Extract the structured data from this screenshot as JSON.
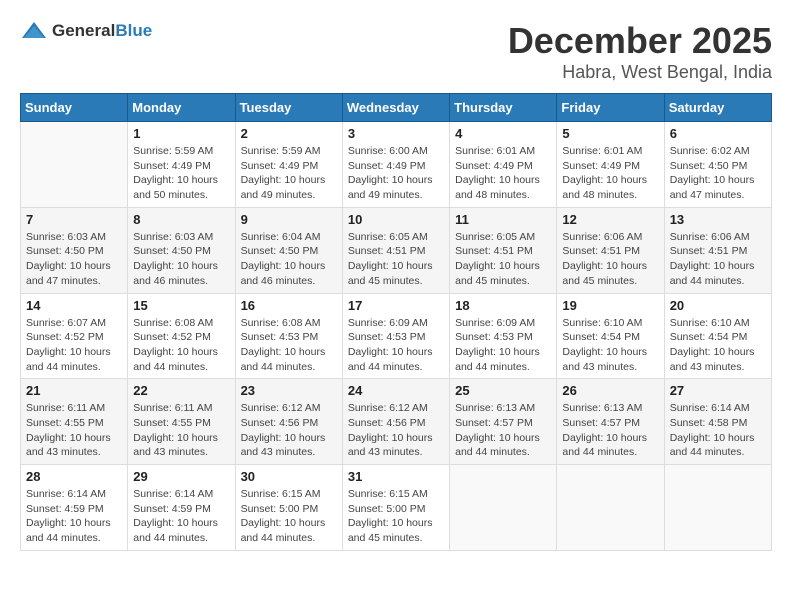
{
  "logo": {
    "general": "General",
    "blue": "Blue"
  },
  "title": {
    "month": "December 2025",
    "location": "Habra, West Bengal, India"
  },
  "weekdays": [
    "Sunday",
    "Monday",
    "Tuesday",
    "Wednesday",
    "Thursday",
    "Friday",
    "Saturday"
  ],
  "weeks": [
    [
      {
        "day": "",
        "sunrise": "",
        "sunset": "",
        "daylight": ""
      },
      {
        "day": "1",
        "sunrise": "Sunrise: 5:59 AM",
        "sunset": "Sunset: 4:49 PM",
        "daylight": "Daylight: 10 hours and 50 minutes."
      },
      {
        "day": "2",
        "sunrise": "Sunrise: 5:59 AM",
        "sunset": "Sunset: 4:49 PM",
        "daylight": "Daylight: 10 hours and 49 minutes."
      },
      {
        "day": "3",
        "sunrise": "Sunrise: 6:00 AM",
        "sunset": "Sunset: 4:49 PM",
        "daylight": "Daylight: 10 hours and 49 minutes."
      },
      {
        "day": "4",
        "sunrise": "Sunrise: 6:01 AM",
        "sunset": "Sunset: 4:49 PM",
        "daylight": "Daylight: 10 hours and 48 minutes."
      },
      {
        "day": "5",
        "sunrise": "Sunrise: 6:01 AM",
        "sunset": "Sunset: 4:49 PM",
        "daylight": "Daylight: 10 hours and 48 minutes."
      },
      {
        "day": "6",
        "sunrise": "Sunrise: 6:02 AM",
        "sunset": "Sunset: 4:50 PM",
        "daylight": "Daylight: 10 hours and 47 minutes."
      }
    ],
    [
      {
        "day": "7",
        "sunrise": "Sunrise: 6:03 AM",
        "sunset": "Sunset: 4:50 PM",
        "daylight": "Daylight: 10 hours and 47 minutes."
      },
      {
        "day": "8",
        "sunrise": "Sunrise: 6:03 AM",
        "sunset": "Sunset: 4:50 PM",
        "daylight": "Daylight: 10 hours and 46 minutes."
      },
      {
        "day": "9",
        "sunrise": "Sunrise: 6:04 AM",
        "sunset": "Sunset: 4:50 PM",
        "daylight": "Daylight: 10 hours and 46 minutes."
      },
      {
        "day": "10",
        "sunrise": "Sunrise: 6:05 AM",
        "sunset": "Sunset: 4:51 PM",
        "daylight": "Daylight: 10 hours and 45 minutes."
      },
      {
        "day": "11",
        "sunrise": "Sunrise: 6:05 AM",
        "sunset": "Sunset: 4:51 PM",
        "daylight": "Daylight: 10 hours and 45 minutes."
      },
      {
        "day": "12",
        "sunrise": "Sunrise: 6:06 AM",
        "sunset": "Sunset: 4:51 PM",
        "daylight": "Daylight: 10 hours and 45 minutes."
      },
      {
        "day": "13",
        "sunrise": "Sunrise: 6:06 AM",
        "sunset": "Sunset: 4:51 PM",
        "daylight": "Daylight: 10 hours and 44 minutes."
      }
    ],
    [
      {
        "day": "14",
        "sunrise": "Sunrise: 6:07 AM",
        "sunset": "Sunset: 4:52 PM",
        "daylight": "Daylight: 10 hours and 44 minutes."
      },
      {
        "day": "15",
        "sunrise": "Sunrise: 6:08 AM",
        "sunset": "Sunset: 4:52 PM",
        "daylight": "Daylight: 10 hours and 44 minutes."
      },
      {
        "day": "16",
        "sunrise": "Sunrise: 6:08 AM",
        "sunset": "Sunset: 4:53 PM",
        "daylight": "Daylight: 10 hours and 44 minutes."
      },
      {
        "day": "17",
        "sunrise": "Sunrise: 6:09 AM",
        "sunset": "Sunset: 4:53 PM",
        "daylight": "Daylight: 10 hours and 44 minutes."
      },
      {
        "day": "18",
        "sunrise": "Sunrise: 6:09 AM",
        "sunset": "Sunset: 4:53 PM",
        "daylight": "Daylight: 10 hours and 44 minutes."
      },
      {
        "day": "19",
        "sunrise": "Sunrise: 6:10 AM",
        "sunset": "Sunset: 4:54 PM",
        "daylight": "Daylight: 10 hours and 43 minutes."
      },
      {
        "day": "20",
        "sunrise": "Sunrise: 6:10 AM",
        "sunset": "Sunset: 4:54 PM",
        "daylight": "Daylight: 10 hours and 43 minutes."
      }
    ],
    [
      {
        "day": "21",
        "sunrise": "Sunrise: 6:11 AM",
        "sunset": "Sunset: 4:55 PM",
        "daylight": "Daylight: 10 hours and 43 minutes."
      },
      {
        "day": "22",
        "sunrise": "Sunrise: 6:11 AM",
        "sunset": "Sunset: 4:55 PM",
        "daylight": "Daylight: 10 hours and 43 minutes."
      },
      {
        "day": "23",
        "sunrise": "Sunrise: 6:12 AM",
        "sunset": "Sunset: 4:56 PM",
        "daylight": "Daylight: 10 hours and 43 minutes."
      },
      {
        "day": "24",
        "sunrise": "Sunrise: 6:12 AM",
        "sunset": "Sunset: 4:56 PM",
        "daylight": "Daylight: 10 hours and 43 minutes."
      },
      {
        "day": "25",
        "sunrise": "Sunrise: 6:13 AM",
        "sunset": "Sunset: 4:57 PM",
        "daylight": "Daylight: 10 hours and 44 minutes."
      },
      {
        "day": "26",
        "sunrise": "Sunrise: 6:13 AM",
        "sunset": "Sunset: 4:57 PM",
        "daylight": "Daylight: 10 hours and 44 minutes."
      },
      {
        "day": "27",
        "sunrise": "Sunrise: 6:14 AM",
        "sunset": "Sunset: 4:58 PM",
        "daylight": "Daylight: 10 hours and 44 minutes."
      }
    ],
    [
      {
        "day": "28",
        "sunrise": "Sunrise: 6:14 AM",
        "sunset": "Sunset: 4:59 PM",
        "daylight": "Daylight: 10 hours and 44 minutes."
      },
      {
        "day": "29",
        "sunrise": "Sunrise: 6:14 AM",
        "sunset": "Sunset: 4:59 PM",
        "daylight": "Daylight: 10 hours and 44 minutes."
      },
      {
        "day": "30",
        "sunrise": "Sunrise: 6:15 AM",
        "sunset": "Sunset: 5:00 PM",
        "daylight": "Daylight: 10 hours and 44 minutes."
      },
      {
        "day": "31",
        "sunrise": "Sunrise: 6:15 AM",
        "sunset": "Sunset: 5:00 PM",
        "daylight": "Daylight: 10 hours and 45 minutes."
      },
      {
        "day": "",
        "sunrise": "",
        "sunset": "",
        "daylight": ""
      },
      {
        "day": "",
        "sunrise": "",
        "sunset": "",
        "daylight": ""
      },
      {
        "day": "",
        "sunrise": "",
        "sunset": "",
        "daylight": ""
      }
    ]
  ]
}
